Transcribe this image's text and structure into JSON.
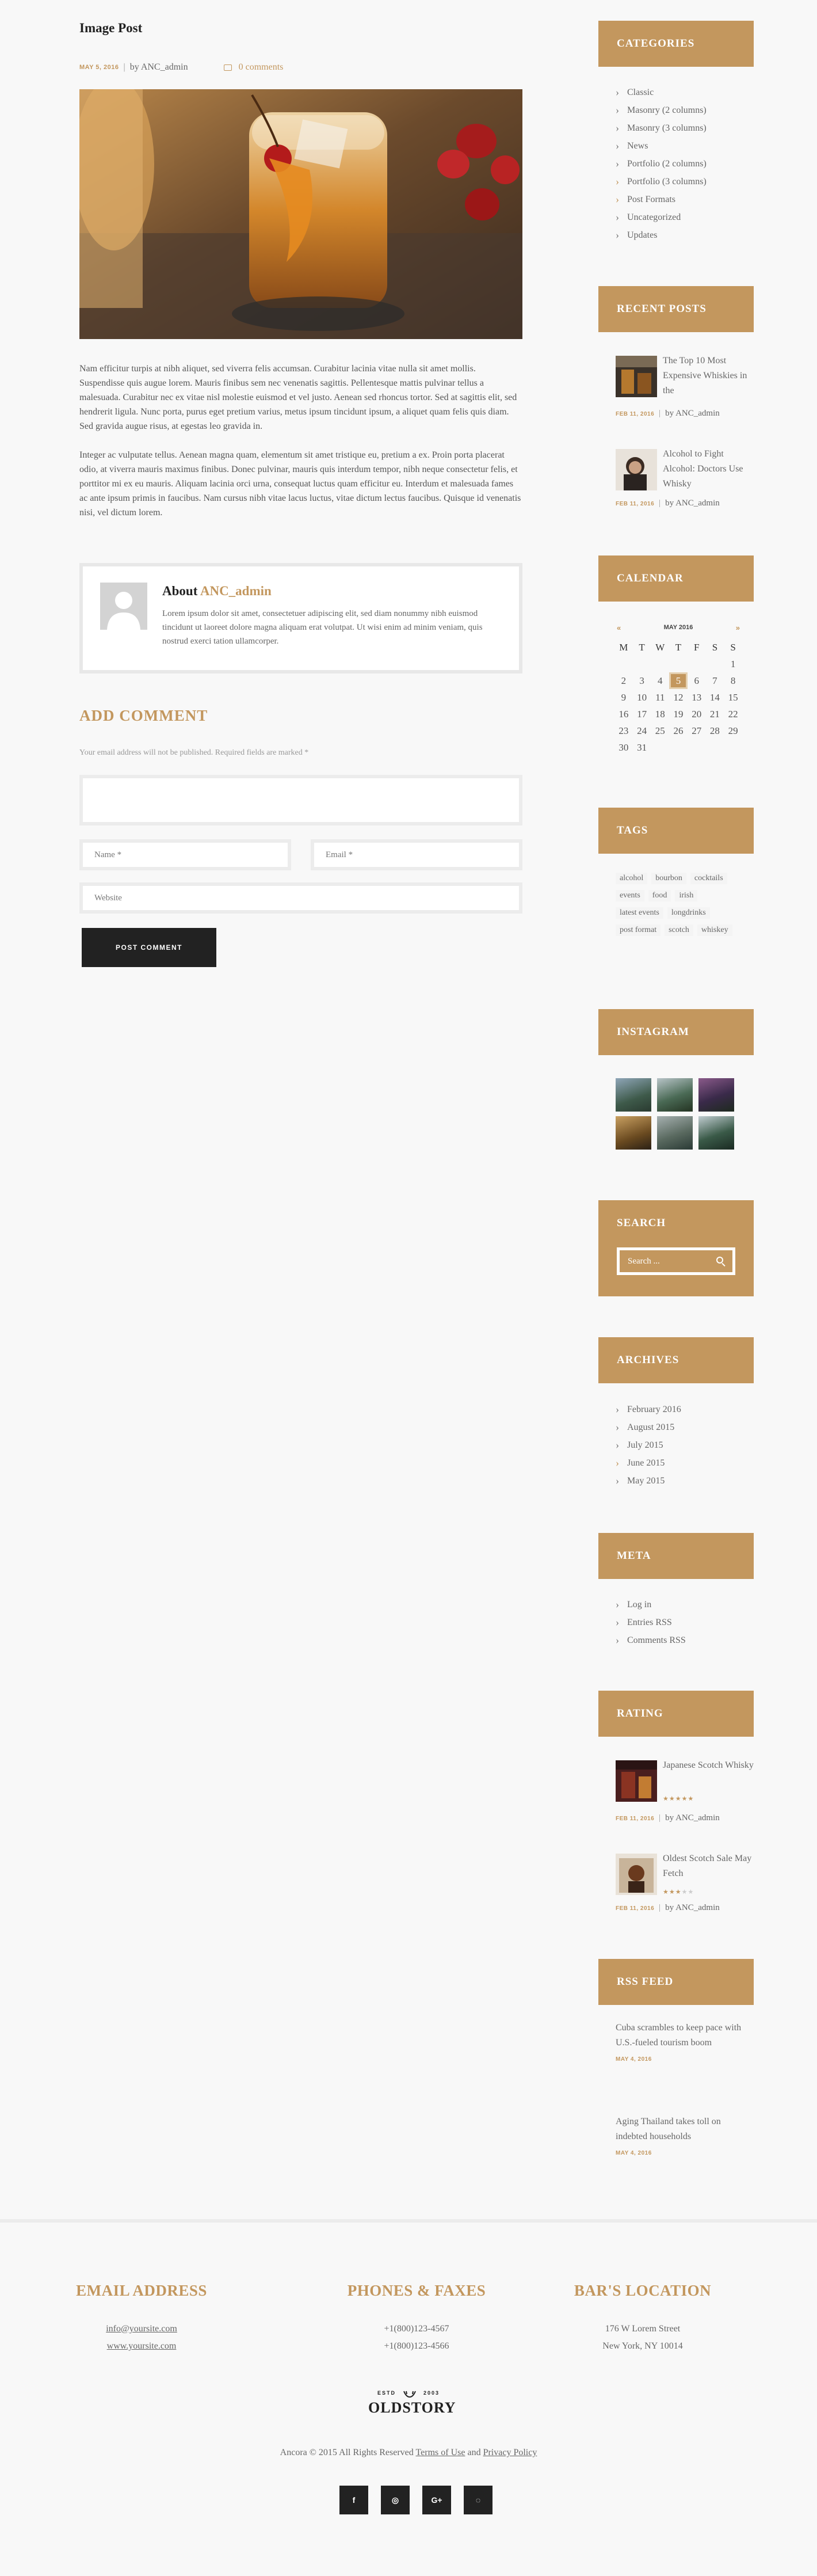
{
  "post": {
    "title": "Image Post",
    "date": "MAY 5, 2016",
    "author": "by ANC_admin",
    "comments": "0 comments",
    "paragraphs": [
      "Nam efficitur turpis at nibh aliquet, sed viverra felis accumsan. Curabitur lacinia vitae nulla sit amet mollis. Suspendisse quis augue lorem. Mauris finibus sem nec venenatis sagittis. Pellentesque mattis pulvinar tellus a malesuada. Curabitur nec ex vitae nisl molestie euismod et vel justo. Aenean sed rhoncus tortor. Sed at sagittis elit, sed hendrerit ligula. Nunc porta, purus eget pretium varius, metus ipsum tincidunt ipsum, a aliquet quam felis quis diam. Sed gravida augue risus, at egestas leo gravida in.",
      "Integer ac vulputate tellus. Aenean magna quam, elementum sit amet tristique eu, pretium a ex. Proin porta placerat odio, at viverra mauris maximus finibus. Donec pulvinar, mauris quis interdum tempor, nibh neque consectetur felis, et porttitor mi ex eu mauris. Aliquam lacinia orci urna, consequat luctus quam efficitur eu. Interdum et malesuada fames ac ante ipsum primis in faucibus. Nam cursus nibh vitae lacus luctus, vitae dictum lectus faucibus. Quisque id venenatis nisi, vel dictum lorem."
    ]
  },
  "author_box": {
    "about": "About",
    "name": "ANC_admin",
    "bio": "Lorem ipsum dolor sit amet, consectetuer adipiscing elit, sed diam nonummy nibh euismod tincidunt ut laoreet dolore magna aliquam erat volutpat. Ut wisi enim ad minim veniam, quis nostrud exerci tation ullamcorper."
  },
  "comment_form": {
    "heading": "ADD COMMENT",
    "note": "Your email address will not be published. Required fields are marked *",
    "name_placeholder": "Name *",
    "email_placeholder": "Email *",
    "website_placeholder": "Website",
    "submit": "POST COMMENT"
  },
  "sidebar": {
    "categories": {
      "title": "CATEGORIES",
      "items": [
        "Classic",
        "Masonry (2 columns)",
        "Masonry (3 columns)",
        "News",
        "Portfolio (2 columns)",
        "Portfolio (3 columns)",
        "Post Formats",
        "Uncategorized",
        "Updates"
      ]
    },
    "recent_posts": {
      "title": "RECENT POSTS",
      "items": [
        {
          "title": "The Top 10 Most Expensive Whiskies in the",
          "date": "FEB 11, 2016",
          "author": "by ANC_admin"
        },
        {
          "title": "Alcohol to Fight Alcohol: Doctors Use Whisky",
          "date": "FEB 11, 2016",
          "author": "by ANC_admin"
        }
      ]
    },
    "calendar": {
      "title": "CALENDAR",
      "month": "MAY 2016",
      "prev": "«",
      "next": "»",
      "weekdays": [
        "M",
        "T",
        "W",
        "T",
        "F",
        "S",
        "S"
      ],
      "days": [
        "",
        "",
        "",
        "",
        "",
        "",
        "1",
        "2",
        "3",
        "4",
        "5",
        "6",
        "7",
        "8",
        "9",
        "10",
        "11",
        "12",
        "13",
        "14",
        "15",
        "16",
        "17",
        "18",
        "19",
        "20",
        "21",
        "22",
        "23",
        "24",
        "25",
        "26",
        "27",
        "28",
        "29",
        "30",
        "31",
        "",
        "",
        "",
        "",
        ""
      ],
      "today": "5"
    },
    "tags": {
      "title": "TAGS",
      "items": [
        "alcohol",
        "bourbon",
        "cocktails",
        "events",
        "food",
        "irish",
        "latest events",
        "longdrinks",
        "post format",
        "scotch",
        "whiskey"
      ]
    },
    "instagram": {
      "title": "INSTAGRAM"
    },
    "search": {
      "title": "SEARCH",
      "placeholder": "Search ..."
    },
    "archives": {
      "title": "ARCHIVES",
      "items": [
        "February 2016",
        "August 2015",
        "July 2015",
        "June 2015",
        "May 2015"
      ]
    },
    "meta": {
      "title": "META",
      "items": [
        "Log in",
        "Entries RSS",
        "Comments RSS"
      ]
    },
    "rating": {
      "title": "RATING",
      "items": [
        {
          "title": "Japanese Scotch Whisky",
          "rating": 5,
          "date": "FEB 11, 2016",
          "author": "by ANC_admin"
        },
        {
          "title": "Oldest Scotch Sale May Fetch",
          "rating": 3,
          "date": "FEB 11, 2016",
          "author": "by ANC_admin"
        }
      ]
    },
    "rss": {
      "title": "RSS FEED",
      "items": [
        {
          "title": "Cuba scrambles to keep pace with U.S.-fueled tourism boom",
          "date": "MAY 4, 2016"
        },
        {
          "title": "Aging Thailand takes toll on indebted households",
          "date": "MAY 4, 2016"
        }
      ]
    }
  },
  "footer": {
    "email": {
      "title": "EMAIL ADDRESS",
      "line1": "info@yoursite.com",
      "line2": "www.yoursite.com"
    },
    "phones": {
      "title": "PHONES & FAXES",
      "line1": "+1(800)123-4567",
      "line2": "+1(800)123-4566"
    },
    "location": {
      "title": "BAR'S LOCATION",
      "line1": "176 W Lorem Street",
      "line2": "New York, NY 10014"
    },
    "logo": {
      "estd": "ESTD",
      "year": "2003",
      "name": "OLDSTORY"
    },
    "copyright": {
      "text": "Ancora © 2015 All Rights Reserved",
      "terms": "Terms of Use",
      "and": "and",
      "privacy": "Privacy Policy"
    },
    "socials": [
      "f",
      "◎",
      "G+",
      "◌"
    ]
  },
  "colors": {
    "accent": "#c3975e",
    "dark": "#222222",
    "background": "#f8f8f8"
  }
}
